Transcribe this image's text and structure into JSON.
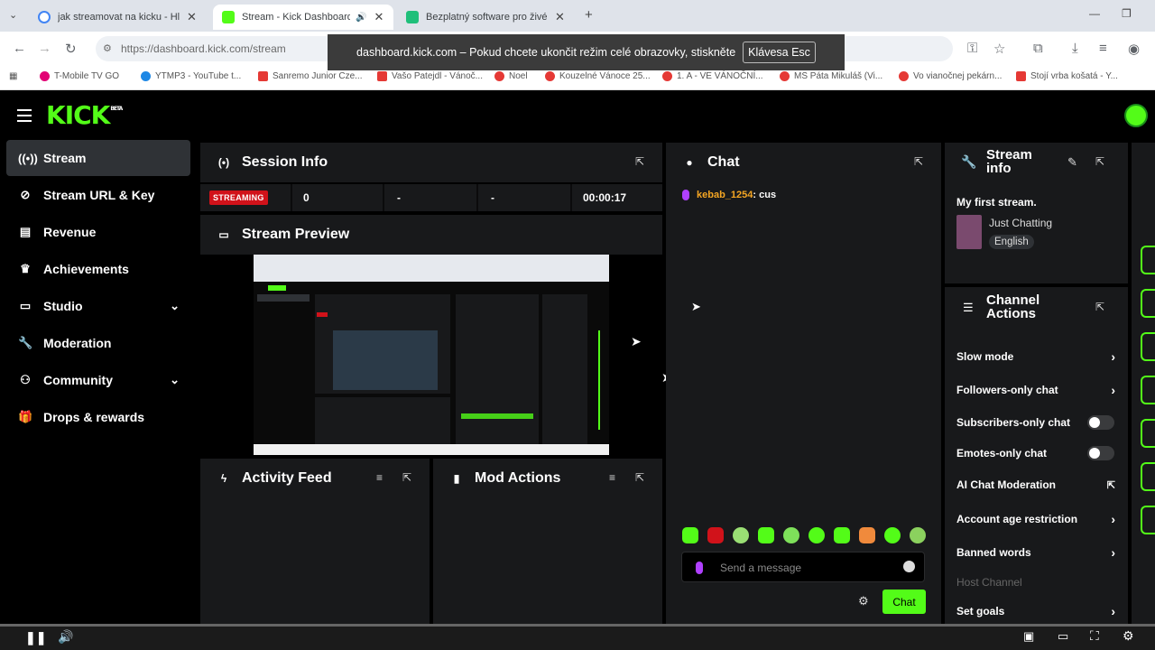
{
  "browser": {
    "tabs": [
      {
        "title": "jak streamovat na kicku - Hledá",
        "active": false
      },
      {
        "title": "Stream - Kick Dashboard",
        "active": true
      },
      {
        "title": "Bezplatný software pro živé str",
        "active": false
      }
    ],
    "url": "https://dashboard.kick.com/stream",
    "bookmarks": [
      "T-Mobile TV GO",
      "YTMP3 - YouTube t...",
      "Sanremo Junior Cze...",
      "Vašo Patejdl - Vánoč...",
      "Noel",
      "Kouzelné Vánoce 25...",
      "1. A - VE VÁNOČNÍ...",
      "MS Páta Mikuláš (Vi...",
      "Vo vianočnej pekárn...",
      "Stojí vrba košatá - Y..."
    ],
    "fullscreen_notice": "dashboard.kick.com – Pokud chcete ukončit režim celé obrazovky, stiskněte",
    "fullscreen_key": "Klávesa Esc"
  },
  "header": {
    "logo": "KICK",
    "logo_sup": "BETA"
  },
  "sidebar": {
    "items": [
      {
        "label": "Stream",
        "icon": "broadcast-icon",
        "active": true
      },
      {
        "label": "Stream URL & Key",
        "icon": "link-icon"
      },
      {
        "label": "Revenue",
        "icon": "chart-icon"
      },
      {
        "label": "Achievements",
        "icon": "trophy-icon"
      },
      {
        "label": "Studio",
        "icon": "studio-icon",
        "expandable": true
      },
      {
        "label": "Moderation",
        "icon": "wrench-icon"
      },
      {
        "label": "Community",
        "icon": "people-icon",
        "expandable": true
      },
      {
        "label": "Drops & rewards",
        "icon": "gift-icon"
      }
    ]
  },
  "session": {
    "title": "Session Info",
    "badge": "STREAMING",
    "viewers": "0",
    "stat2": "-",
    "stat3": "-",
    "duration": "00:00:17"
  },
  "preview": {
    "title": "Stream Preview"
  },
  "activity": {
    "title": "Activity Feed"
  },
  "mod_actions": {
    "title": "Mod Actions"
  },
  "chat": {
    "title": "Chat",
    "messages": [
      {
        "user": "kebab_1254",
        "text": ": cus"
      }
    ],
    "placeholder": "Send a message",
    "send_label": "Chat"
  },
  "stream_info": {
    "title_line1": "Stream",
    "title_line2": "info",
    "stream_title": "My first stream.",
    "category": "Just Chatting",
    "language": "English"
  },
  "channel_actions": {
    "title_line1": "Channel",
    "title_line2": "Actions",
    "rows": [
      {
        "label": "Slow mode",
        "control": "arrow"
      },
      {
        "label": "Followers-only chat",
        "control": "arrow"
      },
      {
        "label": "Subscribers-only chat",
        "control": "toggle",
        "on": false
      },
      {
        "label": "Emotes-only chat",
        "control": "toggle",
        "on": false
      },
      {
        "label": "AI Chat Moderation",
        "control": "external"
      },
      {
        "label": "Account age restriction",
        "control": "arrow"
      },
      {
        "label": "Banned words",
        "control": "arrow"
      },
      {
        "label": "Host Channel",
        "control": "none",
        "disabled": true
      },
      {
        "label": "Set goals",
        "control": "arrow"
      }
    ]
  },
  "colors": {
    "accent": "#53fc18",
    "panel": "#18191b",
    "live": "#d1121a",
    "username": "#f5a623"
  }
}
